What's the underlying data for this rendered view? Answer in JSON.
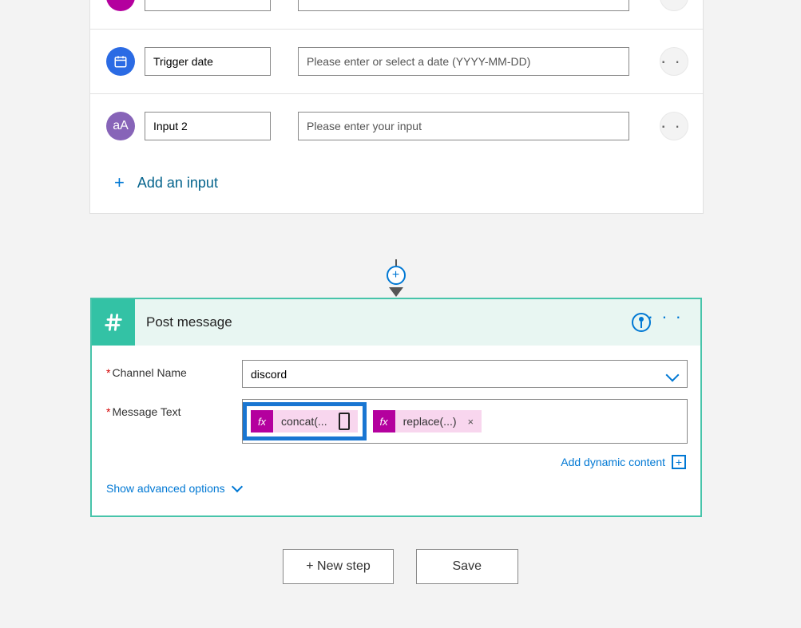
{
  "trigger": {
    "rows": [
      {
        "title": "",
        "placeholder": ""
      },
      {
        "title": "Trigger date",
        "placeholder": "Please enter or select a date (YYYY-MM-DD)"
      },
      {
        "title": "Input 2",
        "placeholder": "Please enter your input"
      }
    ],
    "add_input_label": "Add an input"
  },
  "action": {
    "title": "Post message",
    "fields": {
      "channel_label": "Channel Name",
      "channel_value": "discord",
      "message_label": "Message Text",
      "tokens": [
        {
          "label": "concat(..."
        },
        {
          "label": "replace(...)"
        }
      ]
    },
    "dynamic_content_label": "Add dynamic content",
    "advanced_label": "Show advanced options"
  },
  "footer": {
    "new_step": "+ New step",
    "save": "Save"
  },
  "ellipsis": "· · ·",
  "fx": "fx",
  "plus": "+",
  "x": "×"
}
